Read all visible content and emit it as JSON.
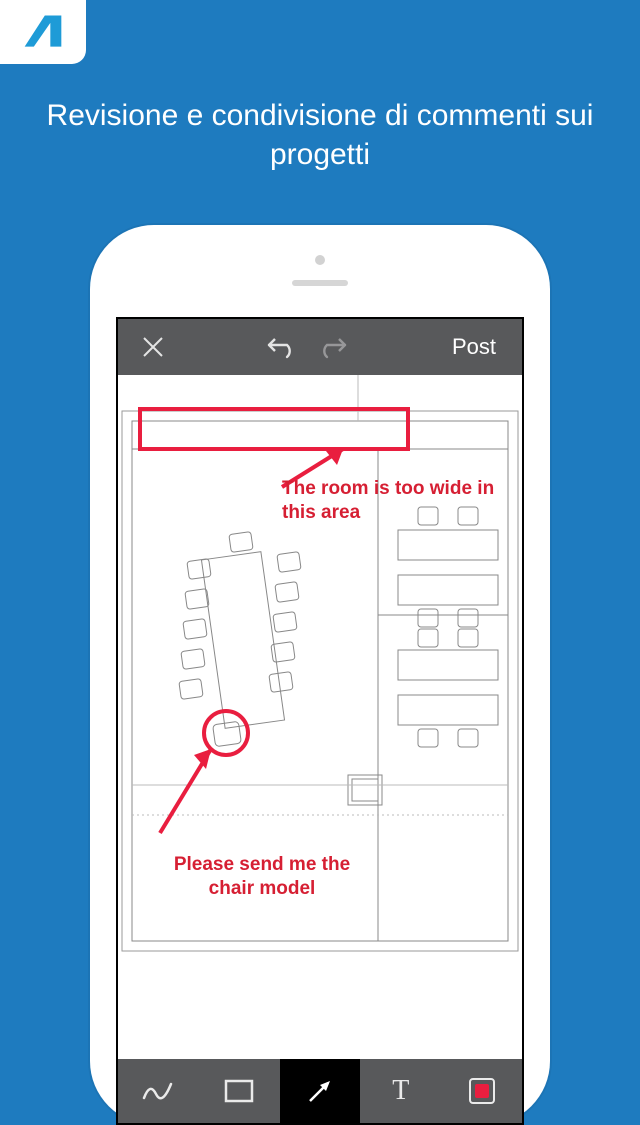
{
  "heading": "Revisione e condivisione di commenti sui progetti",
  "topbar": {
    "post_label": "Post"
  },
  "annotations": {
    "a1": "The room is too wide in this area",
    "a2": "Please send me the chair model"
  },
  "toolbar": {
    "text_tool_label": "T"
  },
  "colors": {
    "bg": "#1e7bbf",
    "annotation": "#d61f33",
    "bar": "#58595b"
  }
}
